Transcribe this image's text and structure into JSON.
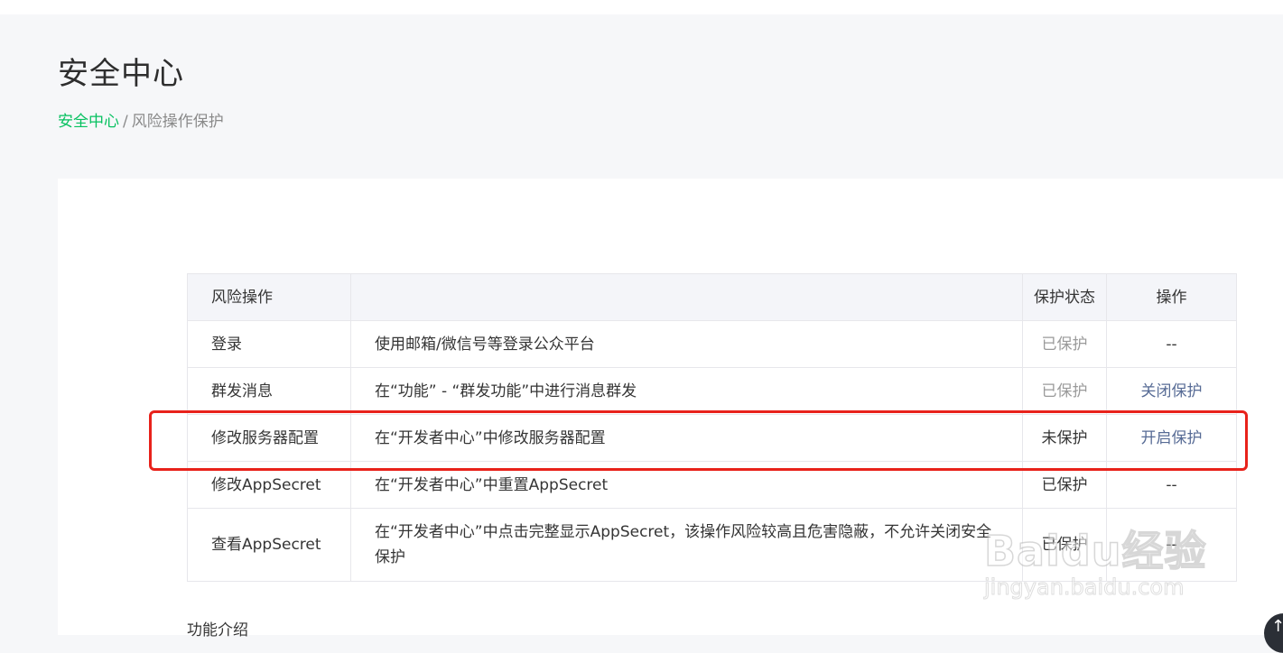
{
  "page": {
    "title": "安全中心"
  },
  "breadcrumb": {
    "home": "安全中心",
    "separator": "/",
    "current": "风险操作保护"
  },
  "table": {
    "headers": {
      "operation": "风险操作",
      "description": "",
      "status": "保护状态",
      "action": "操作"
    },
    "rows": [
      {
        "operation": "登录",
        "description": "使用邮箱/微信号等登录公众平台",
        "status": "已保护",
        "action": "--"
      },
      {
        "operation": "群发消息",
        "description": "在“功能” - “群发功能”中进行消息群发",
        "status": "已保护",
        "action": "关闭保护"
      },
      {
        "operation": "修改服务器配置",
        "description": "在“开发者中心”中修改服务器配置",
        "status": "未保护",
        "action": "开启保护"
      },
      {
        "operation": "修改AppSecret",
        "description": "在“开发者中心”中重置AppSecret",
        "status": "已保护",
        "action": "--"
      },
      {
        "operation": "查看AppSecret",
        "description": "在“开发者中心”中点击完整显示AppSecret，该操作风险较高且危害隐蔽，不允许关闭安全保护",
        "status": "已保护",
        "action": "--"
      }
    ]
  },
  "section": {
    "intro_label": "功能介绍"
  },
  "watermark": {
    "brand": "Baidu经验",
    "url": "jingyan.baidu.com"
  },
  "colors": {
    "accent_green": "#07c160",
    "link_blue": "#576b95",
    "highlight_red": "#e8221b"
  },
  "icons": {
    "scroll_top": "arrow-up-icon"
  }
}
